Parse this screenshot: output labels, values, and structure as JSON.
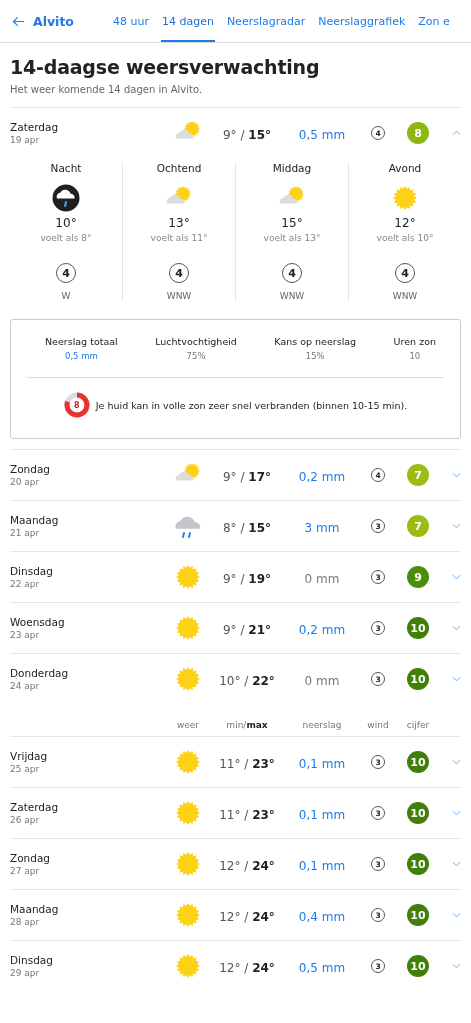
{
  "nav": {
    "back_label": "Alvito",
    "tabs": [
      {
        "label": "48 uur",
        "selected": false
      },
      {
        "label": "14 dagen",
        "selected": true
      },
      {
        "label": "Neerslagradar",
        "selected": false
      },
      {
        "label": "Neerslaggrafiek",
        "selected": false
      },
      {
        "label": "Zon e",
        "selected": false
      }
    ]
  },
  "title": "14-daagse weersverwachting",
  "subtitle": "Het weer komende 14 dagen in Alvito.",
  "days": [
    {
      "day": "Zaterdag",
      "date": "19 apr",
      "weather": {
        "kind": "partly"
      },
      "temps": "9° / **15°**",
      "precip": "0,5 mm",
      "wet": true,
      "wind": "4",
      "score": "8",
      "color": "#8cb813",
      "expanded": true,
      "details": {
        "periods": [
          {
            "name": "Nacht",
            "weather": {
              "kind": "night-rain"
            },
            "temp": "10°",
            "feels": "voelt als 8°",
            "wind": "4",
            "direction": "W"
          },
          {
            "name": "Ochtend",
            "weather": {
              "kind": "partly"
            },
            "temp": "13°",
            "feels": "voelt als 11°",
            "wind": "4",
            "direction": "WNW"
          },
          {
            "name": "Middag",
            "weather": {
              "kind": "partly"
            },
            "temp": "15°",
            "feels": "voelt als 13°",
            "wind": "4",
            "direction": "WNW"
          },
          {
            "name": "Avond",
            "weather": {
              "kind": "sun"
            },
            "temp": "12°",
            "feels": "voelt als 10°",
            "wind": "4",
            "direction": "WNW"
          }
        ],
        "stats": [
          {
            "label": "Neerslag totaal",
            "value": "0,5 mm",
            "wet": true
          },
          {
            "label": "Luchtvochtigheid",
            "value": "75%",
            "wet": false
          },
          {
            "label": "Kans op neerslag",
            "value": "15%",
            "wet": false
          },
          {
            "label": "Uren zon",
            "value": "10",
            "wet": false
          }
        ],
        "uv": {
          "index": "8",
          "level": 0.8,
          "text": "Je huid kan in volle zon zeer snel verbranden (binnen 10-15 min)."
        }
      }
    },
    {
      "day": "Zondag",
      "date": "20 apr",
      "weather": {
        "kind": "partly"
      },
      "temps": "9° / **17°**",
      "precip": "0,2 mm",
      "wet": true,
      "wind": "4",
      "score": "7",
      "color": "#9bbd12",
      "expanded": false
    },
    {
      "day": "Maandag",
      "date": "21 apr",
      "weather": {
        "kind": "rain"
      },
      "temps": "8° / **15°**",
      "precip": "3 mm",
      "wet": true,
      "wind": "3",
      "score": "7",
      "color": "#9bbd12",
      "expanded": false
    },
    {
      "day": "Dinsdag",
      "date": "22 apr",
      "weather": {
        "kind": "sun"
      },
      "temps": "9° / **19°**",
      "precip": "0 mm",
      "wet": false,
      "wind": "3",
      "score": "9",
      "color": "#4a8f0b",
      "expanded": false
    },
    {
      "day": "Woensdag",
      "date": "23 apr",
      "weather": {
        "kind": "sun"
      },
      "temps": "9° / **21°**",
      "precip": "0,2 mm",
      "wet": true,
      "wind": "3",
      "score": "10",
      "color": "#3f7f0a",
      "expanded": false
    },
    {
      "day": "Donderdag",
      "date": "24 apr",
      "weather": {
        "kind": "sun"
      },
      "temps": "10° / **22°**",
      "precip": "0 mm",
      "wet": false,
      "wind": "3",
      "score": "10",
      "color": "#3f7f0a",
      "expanded": false
    },
    {
      "kind": "header",
      "columns": [
        "weer",
        "min/**max**",
        "neerslag",
        "wind",
        "cijfer"
      ]
    },
    {
      "day": "Vrijdag",
      "date": "25 apr",
      "weather": {
        "kind": "sun"
      },
      "temps": "11° / **23°**",
      "precip": "0,1 mm",
      "wet": true,
      "wind": "3",
      "score": "10",
      "color": "#3f7f0a",
      "expanded": false
    },
    {
      "day": "Zaterdag",
      "date": "26 apr",
      "weather": {
        "kind": "sun"
      },
      "temps": "11° / **23°**",
      "precip": "0,1 mm",
      "wet": true,
      "wind": "3",
      "score": "10",
      "color": "#3f7f0a",
      "expanded": false
    },
    {
      "day": "Zondag",
      "date": "27 apr",
      "weather": {
        "kind": "sun"
      },
      "temps": "12° / **24°**",
      "precip": "0,1 mm",
      "wet": true,
      "wind": "3",
      "score": "10",
      "color": "#3f7f0a",
      "expanded": false
    },
    {
      "day": "Maandag",
      "date": "28 apr",
      "weather": {
        "kind": "sun"
      },
      "temps": "12° / **24°**",
      "precip": "0,4 mm",
      "wet": true,
      "wind": "3",
      "score": "10",
      "color": "#3f7f0a",
      "expanded": false
    },
    {
      "day": "Dinsdag",
      "date": "29 apr",
      "weather": {
        "kind": "sun"
      },
      "temps": "12° / **24°**",
      "precip": "0,5 mm",
      "wet": true,
      "wind": "3",
      "score": "10",
      "color": "#3f7f0a",
      "expanded": false
    }
  ]
}
